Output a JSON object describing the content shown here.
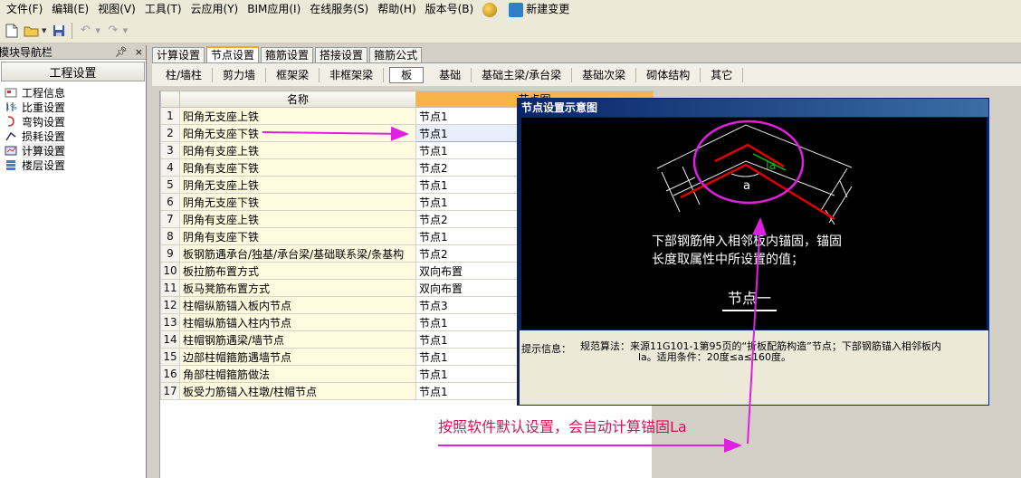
{
  "menu": {
    "items": [
      "文件(F)",
      "编辑(E)",
      "视图(V)",
      "工具(T)",
      "云应用(Y)",
      "BIM应用(I)",
      "在线服务(S)",
      "帮助(H)",
      "版本号(B)"
    ],
    "new_change": "新建变更"
  },
  "toolbar": {
    "icons": [
      "new-file-icon",
      "open-folder-icon",
      "save-icon",
      "undo-icon",
      "redo-icon"
    ]
  },
  "nav": {
    "header": "模块导航栏",
    "pin": "ą",
    "close": "×",
    "title": "工程设置",
    "items": [
      {
        "label": "工程信息",
        "icon": "project-info-icon"
      },
      {
        "label": "比重设置",
        "icon": "weight-icon"
      },
      {
        "label": "弯钩设置",
        "icon": "hook-icon"
      },
      {
        "label": "损耗设置",
        "icon": "loss-icon"
      },
      {
        "label": "计算设置",
        "icon": "calc-icon"
      },
      {
        "label": "楼层设置",
        "icon": "floor-icon"
      }
    ]
  },
  "tabs": [
    "计算设置",
    "节点设置",
    "箍筋设置",
    "搭接设置",
    "箍筋公式"
  ],
  "active_tab": 1,
  "subtabs": [
    "柱/墙柱",
    "剪力墙",
    "框架梁",
    "非框架梁",
    "板",
    "基础",
    "基础主梁/承台梁",
    "基础次梁",
    "砌体结构",
    "其它"
  ],
  "active_subtab": 4,
  "grid": {
    "headers": {
      "name": "名称",
      "node": "节点图"
    },
    "rows": [
      {
        "num": "1",
        "name": "阳角无支座上铁",
        "value": "节点1"
      },
      {
        "num": "2",
        "name": "阳角无支座下铁",
        "value": "节点1"
      },
      {
        "num": "3",
        "name": "阳角有支座上铁",
        "value": "节点1"
      },
      {
        "num": "4",
        "name": "阳角有支座下铁",
        "value": "节点2"
      },
      {
        "num": "5",
        "name": "阴角无支座上铁",
        "value": "节点1"
      },
      {
        "num": "6",
        "name": "阴角无支座下铁",
        "value": "节点1"
      },
      {
        "num": "7",
        "name": "阴角有支座上铁",
        "value": "节点2"
      },
      {
        "num": "8",
        "name": "阴角有支座下铁",
        "value": "节点1"
      },
      {
        "num": "9",
        "name": "板钢筋遇承台/独基/承台梁/基础联系梁/条基构",
        "value": "节点2"
      },
      {
        "num": "10",
        "name": "板拉筋布置方式",
        "value": "双向布置"
      },
      {
        "num": "11",
        "name": "板马凳筋布置方式",
        "value": "双向布置"
      },
      {
        "num": "12",
        "name": "柱帽纵筋锚入板内节点",
        "value": "节点3"
      },
      {
        "num": "13",
        "name": "柱帽纵筋锚入柱内节点",
        "value": "节点1"
      },
      {
        "num": "14",
        "name": "柱帽钢筋遇梁/墙节点",
        "value": "节点1"
      },
      {
        "num": "15",
        "name": "边部柱帽箍筋遇墙节点",
        "value": "节点1"
      },
      {
        "num": "16",
        "name": "角部柱帽箍筋做法",
        "value": "节点1"
      },
      {
        "num": "17",
        "name": "板受力筋锚入柱墩/柱帽节点",
        "value": "节点1"
      }
    ],
    "selected_row": 1
  },
  "dialog": {
    "title": "节点设置示意图",
    "line1": "下部钢筋伸入相邻板内锚固，锚固",
    "line2": "长度取属性中所设置的值；",
    "node_label": "节点一",
    "la_label": "la",
    "a_label": "a",
    "info_label": "提示信息：",
    "info_line1": "规范算法：来源11G101-1第95页的“折板配筋构造”节点；下部钢筋锚入相邻板内",
    "info_line2": "la。适用条件：20度≤a≤160度。"
  },
  "annotation": "按照软件默认设置，会自动计算锚固La",
  "colors": {
    "annotation": "#d4145a",
    "arrow": "#e020e0",
    "rebar": "#e00000",
    "dim": "#00c000"
  }
}
